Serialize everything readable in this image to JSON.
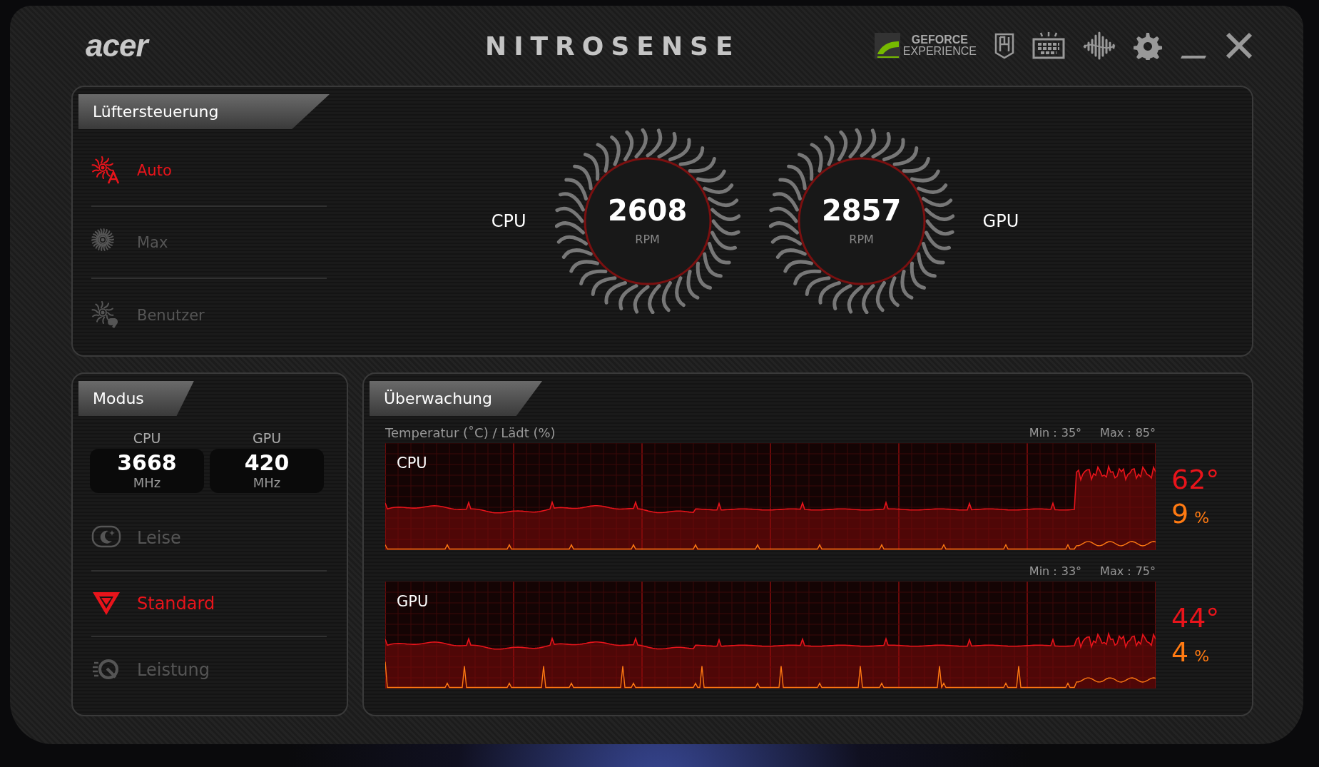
{
  "header": {
    "logo": "acer",
    "title": "NITROSENSE",
    "geforce": [
      "GEFORCE",
      "EXPERIENCE"
    ]
  },
  "fan_control": {
    "title": "Lüftersteuerung",
    "modes": [
      {
        "label": "Auto",
        "selected": true,
        "kind": "auto"
      },
      {
        "label": "Max",
        "selected": false,
        "kind": "max"
      },
      {
        "label": "Benutzer",
        "selected": false,
        "kind": "custom"
      }
    ],
    "fans": [
      {
        "name": "CPU",
        "speed": "2608",
        "unit": "RPM"
      },
      {
        "name": "GPU",
        "speed": "2857",
        "unit": "RPM"
      }
    ]
  },
  "mode": {
    "title": "Modus",
    "clocks": [
      {
        "name": "CPU",
        "value": "3668",
        "unit": "MHz"
      },
      {
        "name": "GPU",
        "value": "420",
        "unit": "MHz"
      }
    ],
    "modes": [
      {
        "label": "Leise",
        "selected": false,
        "kind": "quiet"
      },
      {
        "label": "Standard",
        "selected": true,
        "kind": "standard"
      },
      {
        "label": "Leistung",
        "selected": false,
        "kind": "performance"
      }
    ]
  },
  "monitoring": {
    "title": "Überwachung",
    "subtitle": "Temperatur (˚C) / Lädt (%)",
    "graphs": [
      {
        "name": "CPU",
        "min_label": "Min :",
        "min": "35°",
        "max_label": "Max :",
        "max": "85°",
        "temperature": "62°",
        "load": "9",
        "load_unit": "%"
      },
      {
        "name": "GPU",
        "min_label": "Min :",
        "min": "33°",
        "max_label": "Max :",
        "max": "75°",
        "temperature": "44°",
        "load": "4",
        "load_unit": "%"
      }
    ]
  }
}
